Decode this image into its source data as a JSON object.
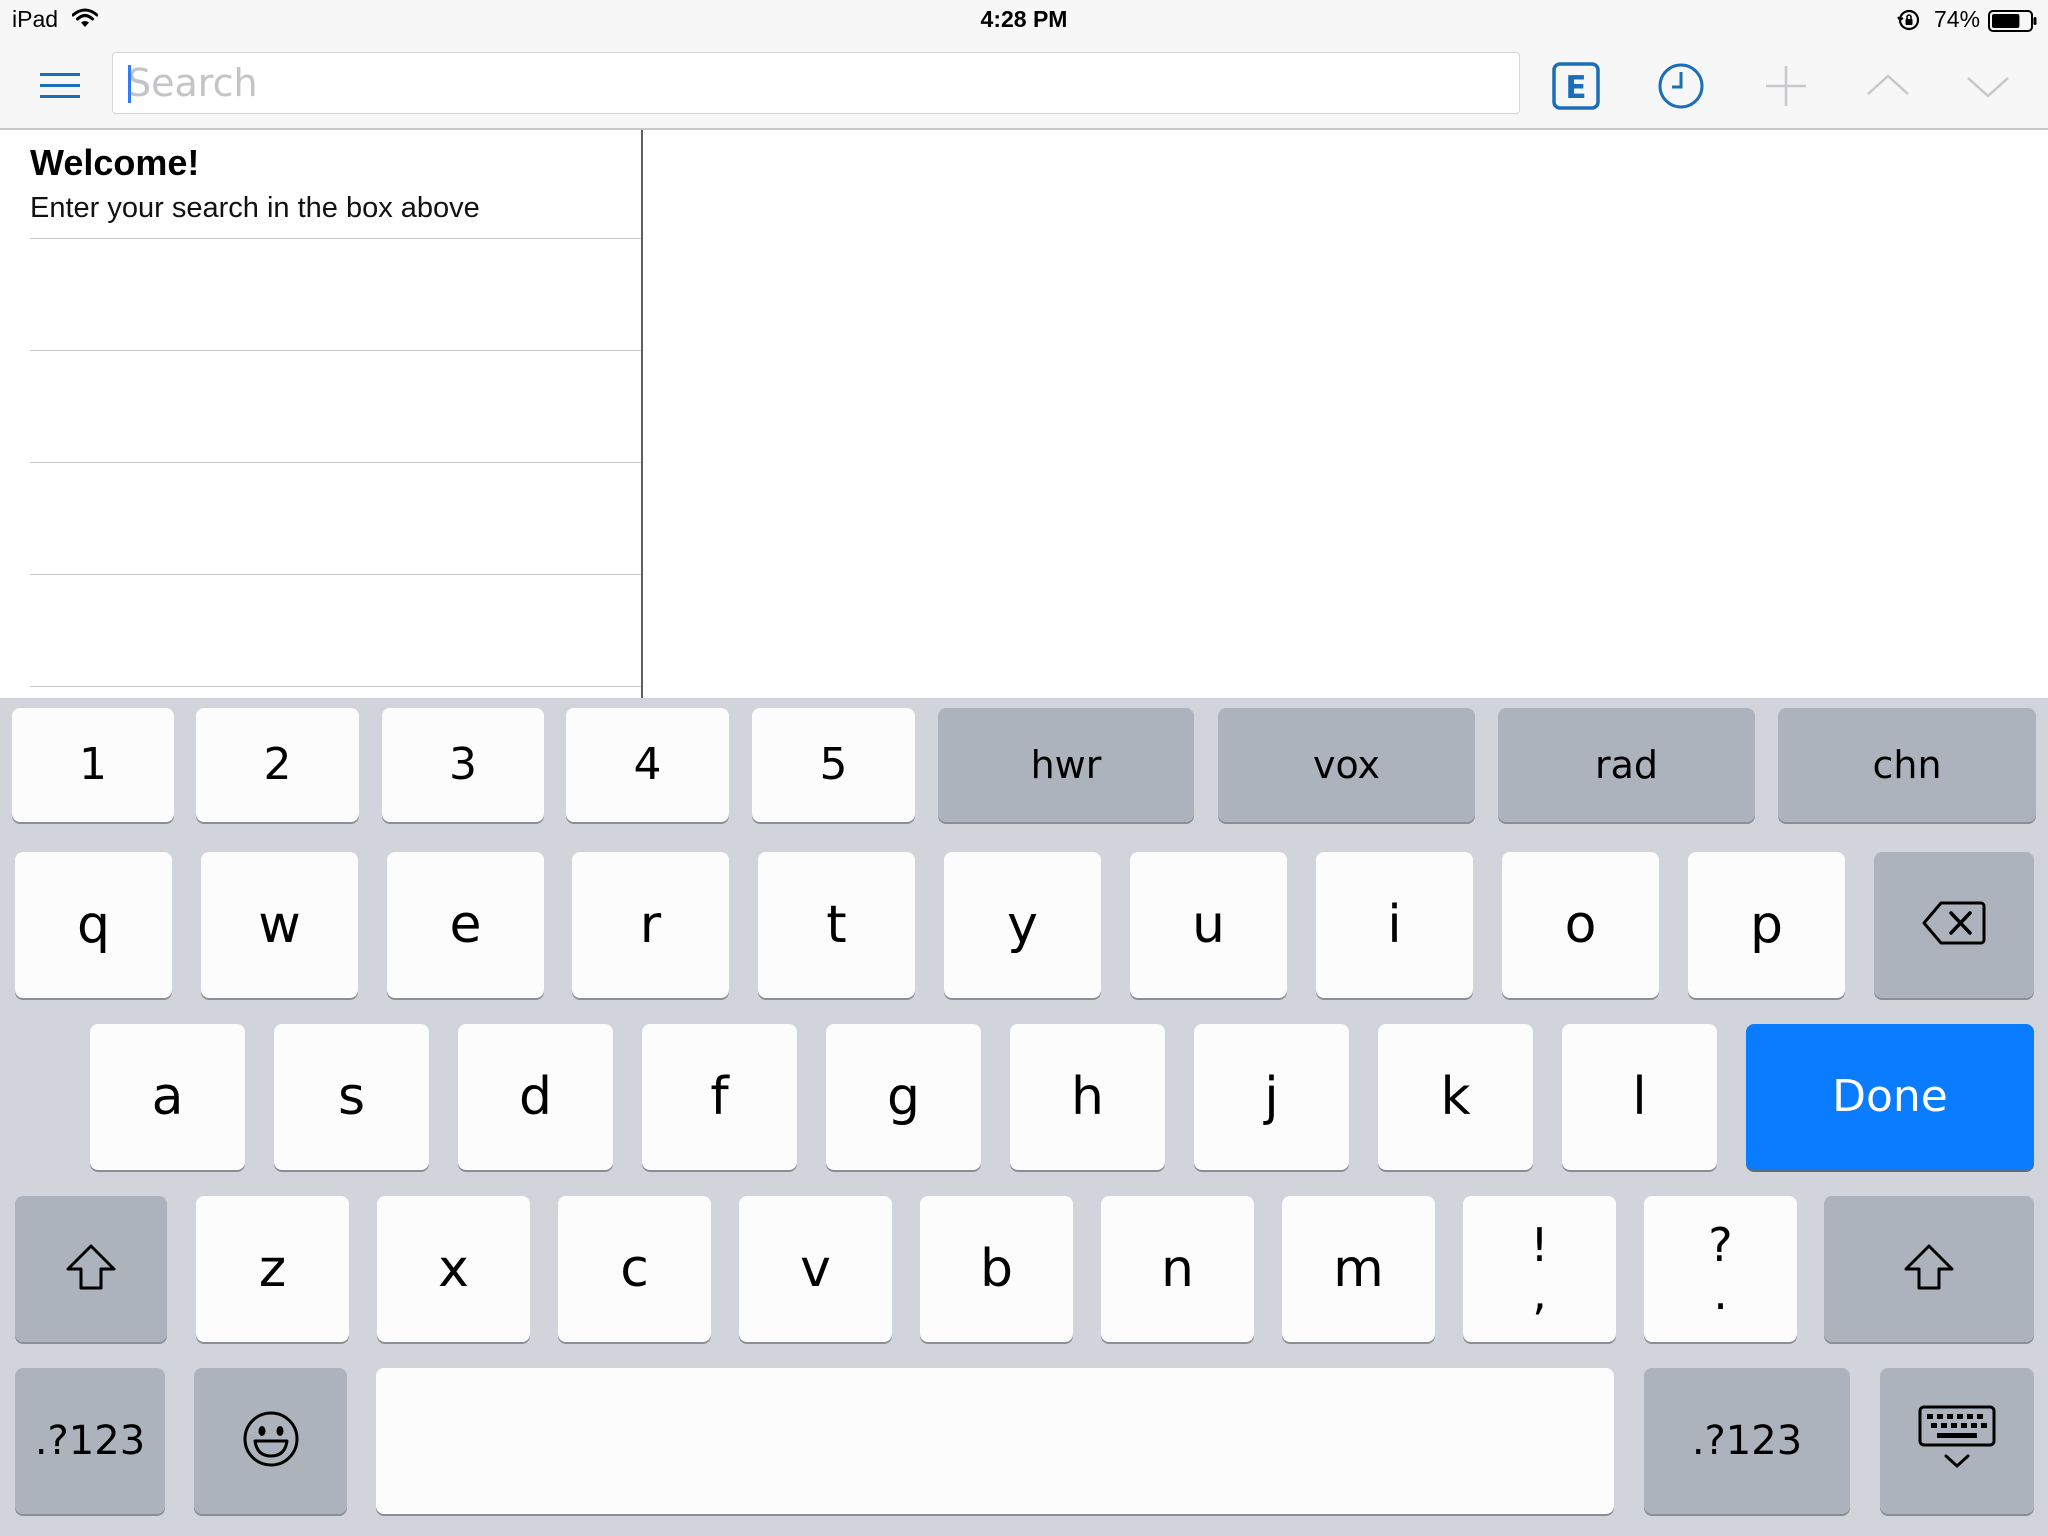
{
  "status_bar": {
    "device": "iPad",
    "time": "4:28 PM",
    "battery": "74%",
    "battery_level": 0.74
  },
  "toolbar": {
    "search": {
      "value": "",
      "placeholder": "Search"
    },
    "icons": [
      "menu-icon",
      "e-dictionary-icon",
      "history-clock-icon",
      "add-icon",
      "chevron-up-icon",
      "chevron-down-icon"
    ],
    "e_badge": "E",
    "accent_color": "#1a6fb8"
  },
  "list": {
    "welcome_title": "Welcome!",
    "welcome_subtitle": "Enter your search in the box above"
  },
  "keyboard": {
    "row1": [
      "1",
      "2",
      "3",
      "4",
      "5"
    ],
    "row1_func": [
      "hwr",
      "vox",
      "rad",
      "chn"
    ],
    "row2": [
      "q",
      "w",
      "e",
      "r",
      "t",
      "y",
      "u",
      "i",
      "o",
      "p"
    ],
    "row3": [
      "a",
      "s",
      "d",
      "f",
      "g",
      "h",
      "j",
      "k",
      "l"
    ],
    "done": "Done",
    "row4": [
      "z",
      "x",
      "c",
      "v",
      "b",
      "n",
      "m"
    ],
    "punct1": {
      "top": "!",
      "bottom": ","
    },
    "punct2": {
      "top": "?",
      "bottom": "."
    },
    "numbers_left": ".?123",
    "numbers_right": ".?123",
    "special_icons": [
      "backspace-icon",
      "shift-icon",
      "emoji-icon",
      "keyboard-dismiss-icon"
    ],
    "done_color": "#0a7cff"
  }
}
